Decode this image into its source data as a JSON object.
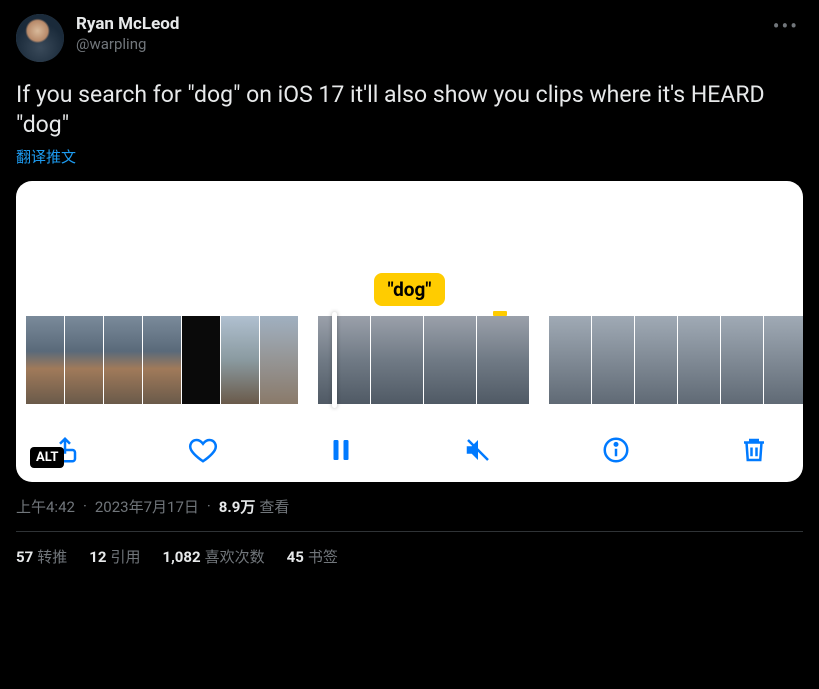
{
  "author": {
    "display_name": "Ryan McLeod",
    "handle": "@warpling"
  },
  "tweet_text": "If you search for \"dog\" on iOS 17 it'll also show you clips where it's HEARD \"dog\"",
  "translate_label": "翻译推文",
  "media": {
    "caption_bubble": "\"dog\"",
    "alt_badge": "ALT",
    "toolbar": {
      "share": "share",
      "like": "like",
      "pause": "pause",
      "mute": "mute",
      "info": "info",
      "delete": "delete"
    }
  },
  "meta": {
    "time": "上午4:42",
    "date": "2023年7月17日",
    "views_count": "8.9万",
    "views_label": "查看"
  },
  "stats": {
    "retweets_count": "57",
    "retweets_label": "转推",
    "quotes_count": "12",
    "quotes_label": "引用",
    "likes_count": "1,082",
    "likes_label": "喜欢次数",
    "bookmarks_count": "45",
    "bookmarks_label": "书签"
  }
}
